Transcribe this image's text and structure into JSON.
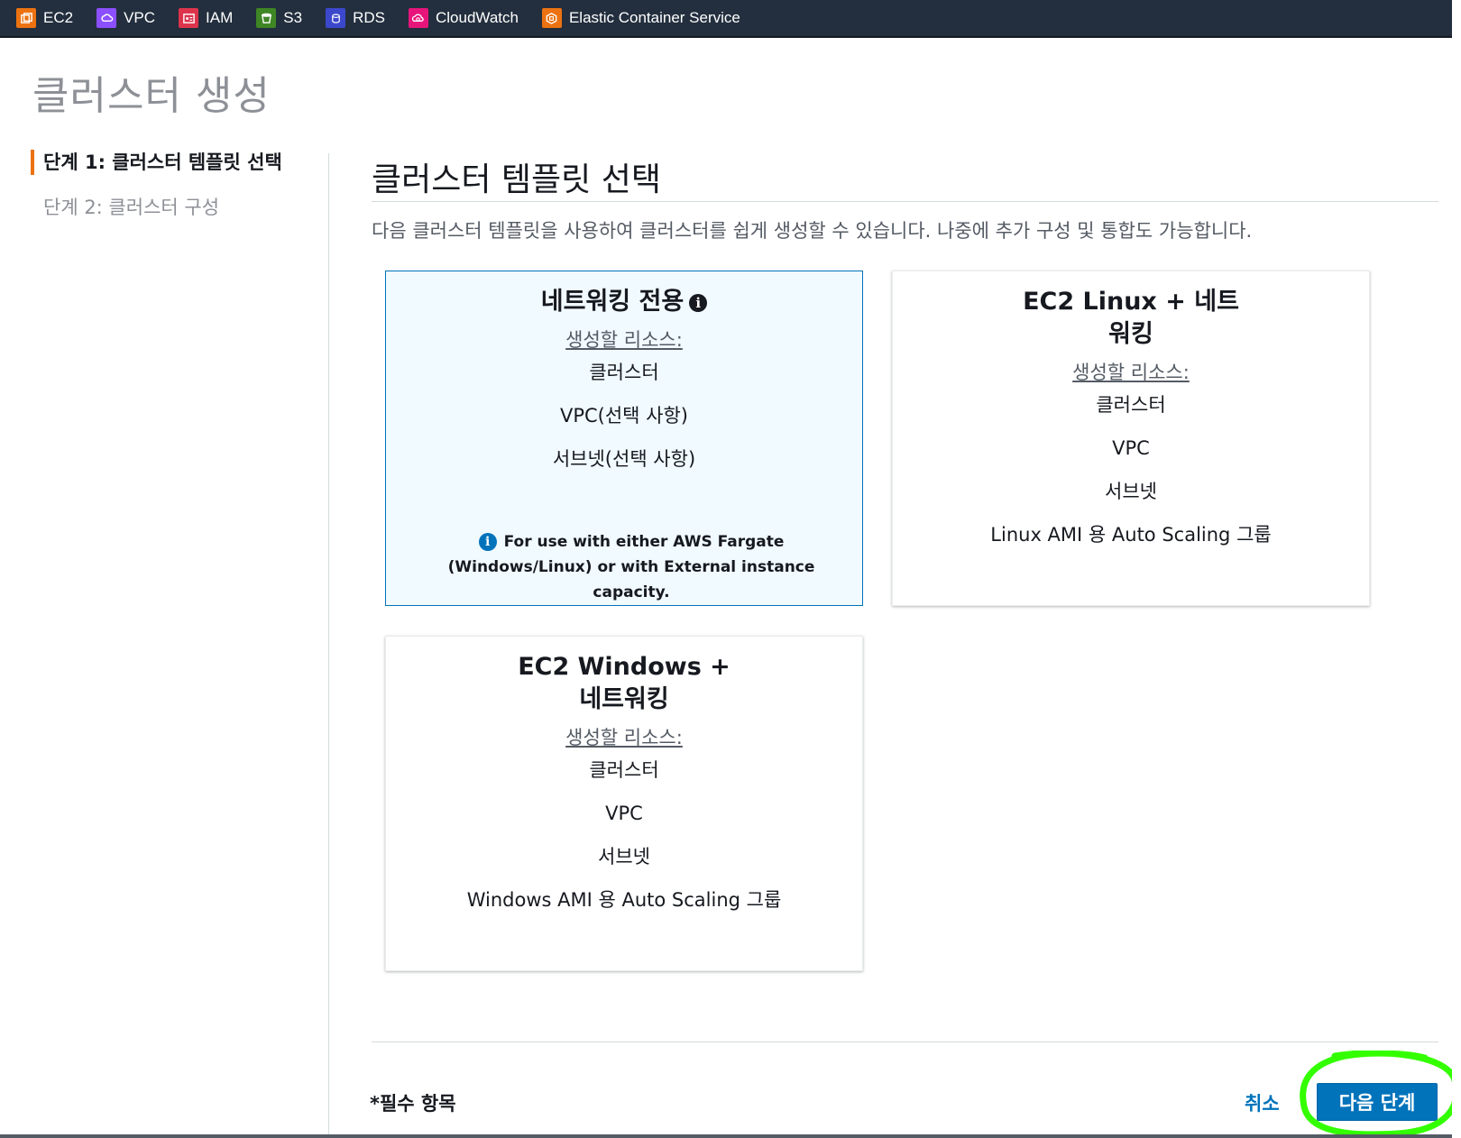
{
  "favorites": [
    {
      "label": "EC2",
      "icon": "ec2-icon",
      "color": "#ec7211"
    },
    {
      "label": "VPC",
      "icon": "vpc-icon",
      "color": "#8c4fff"
    },
    {
      "label": "IAM",
      "icon": "iam-icon",
      "color": "#dd344c"
    },
    {
      "label": "S3",
      "icon": "s3-icon",
      "color": "#3f8624"
    },
    {
      "label": "RDS",
      "icon": "rds-icon",
      "color": "#3b48cc"
    },
    {
      "label": "CloudWatch",
      "icon": "cloudwatch-icon",
      "color": "#e7157b"
    },
    {
      "label": "Elastic Container Service",
      "icon": "ecs-icon",
      "color": "#ec7211"
    }
  ],
  "page": {
    "title": "클러스터 생성"
  },
  "steps": [
    {
      "label": "단계 1: 클러스터 템플릿 선택",
      "active": true
    },
    {
      "label": "단계 2: 클러스터 구성",
      "active": false
    }
  ],
  "section": {
    "title": "클러스터 템플릿 선택",
    "description": "다음 클러스터 템플릿을 사용하여 클러스터를 쉽게 생성할 수 있습니다. 나중에 추가 구성 및 통합도 가능합니다."
  },
  "templates": [
    {
      "title": "네트워킹 전용",
      "selected": true,
      "resources_heading": "생성할 리소스:",
      "resources": [
        "클러스터",
        "VPC(선택 사항)",
        "서브넷(선택 사항)"
      ],
      "note": "For use with either AWS Fargate (Windows/Linux) or with External instance capacity."
    },
    {
      "title": "EC2 Linux + 네트워킹",
      "selected": false,
      "resources_heading": "생성할 리소스:",
      "resources": [
        "클러스터",
        "VPC",
        "서브넷",
        "Linux AMI 용 Auto Scaling 그룹"
      ]
    },
    {
      "title": "EC2 Windows + 네트워킹",
      "selected": false,
      "resources_heading": "생성할 리소스:",
      "resources": [
        "클러스터",
        "VPC",
        "서브넷",
        "Windows AMI 용 Auto Scaling 그룹"
      ]
    }
  ],
  "footer": {
    "required_label": "*필수 항목",
    "cancel_label": "취소",
    "next_label": "다음 단계"
  },
  "colors": {
    "accent": "#ec7211",
    "primary": "#0073bb",
    "highlight": "#33ff00"
  }
}
